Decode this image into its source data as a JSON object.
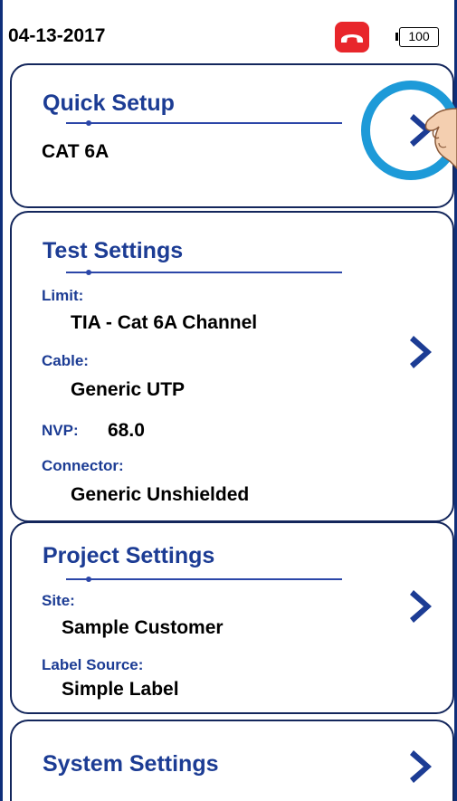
{
  "status_bar": {
    "date": "04-13-2017",
    "battery_level": "100",
    "phone_icon": "phone-hangup-icon",
    "phone_color": "#e8262b"
  },
  "quick_setup": {
    "title": "Quick Setup",
    "value": "CAT 6A"
  },
  "test_settings": {
    "title": "Test Settings",
    "limit_label": "Limit:",
    "limit_value": "TIA - Cat 6A Channel",
    "cable_label": "Cable:",
    "cable_value": "Generic UTP",
    "nvp_label": "NVP:",
    "nvp_value": "68.0",
    "connector_label": "Connector:",
    "connector_value": "Generic Unshielded"
  },
  "project_settings": {
    "title": "Project Settings",
    "site_label": "Site:",
    "site_value": "Sample Customer",
    "label_source_label": "Label Source:",
    "label_source_value": "Simple Label"
  },
  "system_settings": {
    "title": "System Settings"
  },
  "colors": {
    "accent": "#1c3c94",
    "border": "#14275c",
    "highlight_ring": "#1d9ad8"
  }
}
